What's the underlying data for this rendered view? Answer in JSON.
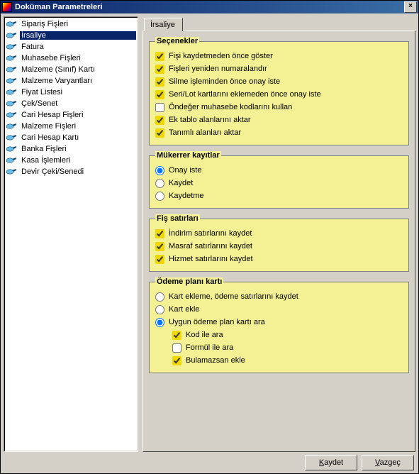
{
  "window": {
    "title": "Doküman Parametreleri"
  },
  "sidebar": {
    "selected_index": 1,
    "items": [
      {
        "label": "Sipariş Fişleri"
      },
      {
        "label": "İrsaliye"
      },
      {
        "label": "Fatura"
      },
      {
        "label": "Muhasebe Fişleri"
      },
      {
        "label": "Malzeme (Sınıf) Kartı"
      },
      {
        "label": "Malzeme Varyantları"
      },
      {
        "label": "Fiyat Listesi"
      },
      {
        "label": "Çek/Senet"
      },
      {
        "label": "Cari Hesap Fişleri"
      },
      {
        "label": "Malzeme Fişleri"
      },
      {
        "label": "Cari Hesap Kartı"
      },
      {
        "label": "Banka Fişleri"
      },
      {
        "label": "Kasa İşlemleri"
      },
      {
        "label": "Devir Çeki/Senedi"
      }
    ]
  },
  "tab": {
    "label": "İrsaliye"
  },
  "groups": {
    "secenekler": {
      "title": "Seçenekler",
      "options": [
        {
          "type": "checkbox",
          "checked": true,
          "label": "Fişi kaydetmeden önce göster"
        },
        {
          "type": "checkbox",
          "checked": true,
          "label": "Fişleri yeniden numaralandır"
        },
        {
          "type": "checkbox",
          "checked": true,
          "label": "Silme işleminden önce onay iste"
        },
        {
          "type": "checkbox",
          "checked": true,
          "label": "Seri/Lot kartlarını eklemeden önce onay iste"
        },
        {
          "type": "checkbox",
          "checked": false,
          "label": "Öndeğer muhasebe kodlarını kullan"
        },
        {
          "type": "checkbox",
          "checked": true,
          "label": "Ek tablo alanlarını aktar"
        },
        {
          "type": "checkbox",
          "checked": true,
          "label": "Tanımlı alanları aktar"
        }
      ]
    },
    "mukerrer": {
      "title": "Mükerrer kayıtlar",
      "options": [
        {
          "type": "radio",
          "checked": true,
          "label": "Onay iste"
        },
        {
          "type": "radio",
          "checked": false,
          "label": "Kaydet"
        },
        {
          "type": "radio",
          "checked": false,
          "label": "Kaydetme"
        }
      ]
    },
    "fis_satirlari": {
      "title": "Fiş satırları",
      "options": [
        {
          "type": "checkbox",
          "checked": true,
          "label": "İndirim satırlarını kaydet"
        },
        {
          "type": "checkbox",
          "checked": true,
          "label": "Masraf satırlarını kaydet"
        },
        {
          "type": "checkbox",
          "checked": true,
          "label": "Hizmet satırlarını kaydet"
        }
      ]
    },
    "odeme_plani": {
      "title": "Ödeme planı kartı",
      "options": [
        {
          "type": "radio",
          "checked": false,
          "label": "Kart ekleme, ödeme satırlarını kaydet"
        },
        {
          "type": "radio",
          "checked": false,
          "label": "Kart ekle"
        },
        {
          "type": "radio",
          "checked": true,
          "label": "Uygun ödeme plan kartı ara"
        },
        {
          "type": "checkbox",
          "checked": true,
          "indent": true,
          "label": "Kod ile ara"
        },
        {
          "type": "checkbox",
          "checked": false,
          "indent": true,
          "label": "Formül ile ara"
        },
        {
          "type": "checkbox",
          "checked": true,
          "indent": true,
          "label": "Bulamazsan ekle"
        }
      ]
    }
  },
  "buttons": {
    "save": "Kaydet",
    "cancel": "Vazgeç"
  }
}
